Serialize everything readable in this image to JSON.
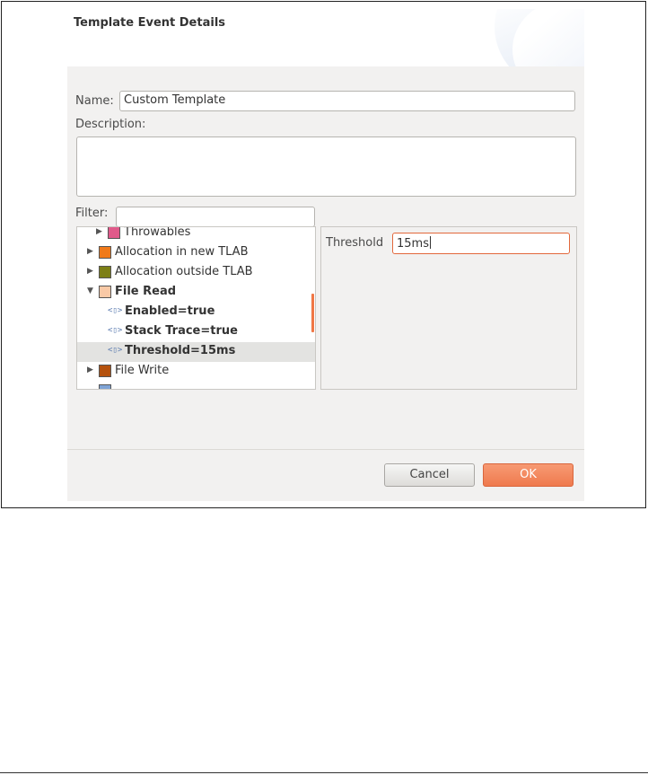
{
  "dialog": {
    "title": "Template Event Details",
    "name_label": "Name:",
    "name_value": "Custom   Template",
    "description_label": "Description:",
    "description_value": "",
    "filter_label": "Filter:",
    "filter_value": ""
  },
  "tree": {
    "rows": [
      {
        "label": "Throwables",
        "type": "event",
        "color": "#e05a8a",
        "expanded": false,
        "bold": false
      },
      {
        "label": "Allocation in new TLAB",
        "type": "event",
        "color": "#f07a1a",
        "expanded": false,
        "bold": false
      },
      {
        "label": "Allocation outside TLAB",
        "type": "event",
        "color": "#7d7f16",
        "expanded": false,
        "bold": false
      },
      {
        "label": "File Read",
        "type": "event",
        "color": "#f9c9a6",
        "expanded": true,
        "bold": true
      },
      {
        "label": "Enabled=true",
        "type": "attribute",
        "bold": true
      },
      {
        "label": "Stack Trace=true",
        "type": "attribute",
        "bold": true
      },
      {
        "label": "Threshold=15ms",
        "type": "attribute",
        "bold": true,
        "selected": true
      },
      {
        "label": "File Write",
        "type": "event",
        "color": "#b5520e",
        "expanded": false,
        "bold": false
      }
    ],
    "partial_row_color": "#7fa4d6"
  },
  "properties": {
    "threshold_label": "Threshold",
    "threshold_value": "15ms"
  },
  "buttons": {
    "cancel": "Cancel",
    "ok": "OK"
  },
  "colors": {
    "accent": "#ef7a4e",
    "focus_border": "#e2683c",
    "panel_bg": "#f2f1f0"
  }
}
